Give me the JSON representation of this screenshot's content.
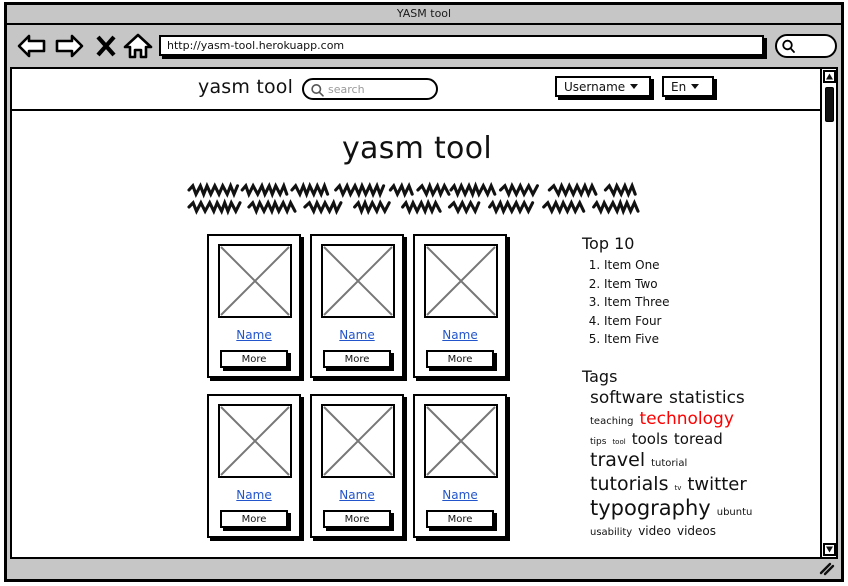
{
  "window": {
    "title": "YASM tool"
  },
  "browser": {
    "back_icon": "back-arrow-icon",
    "forward_icon": "forward-arrow-icon",
    "stop_icon": "close-x-icon",
    "home_icon": "home-icon",
    "url": "http://yasm-tool.herokuapp.com",
    "search_icon": "magnifier-icon"
  },
  "navbar": {
    "logo": "yasm tool",
    "search_placeholder": "search",
    "search_icon": "magnifier-icon",
    "username_label": "Username",
    "language_label": "En"
  },
  "hero": {
    "title": "yasm tool",
    "description_placeholder_lines": 2
  },
  "cards": [
    {
      "name": "Name",
      "button": "More",
      "thumb": "image-placeholder-icon"
    },
    {
      "name": "Name",
      "button": "More",
      "thumb": "image-placeholder-icon"
    },
    {
      "name": "Name",
      "button": "More",
      "thumb": "image-placeholder-icon"
    },
    {
      "name": "Name",
      "button": "More",
      "thumb": "image-placeholder-icon"
    },
    {
      "name": "Name",
      "button": "More",
      "thumb": "image-placeholder-icon"
    },
    {
      "name": "Name",
      "button": "More",
      "thumb": "image-placeholder-icon"
    }
  ],
  "top10": {
    "heading": "Top 10",
    "items": [
      "Item One",
      "Item Two",
      "Item Three",
      "Item Four",
      "Item Five"
    ]
  },
  "tags": {
    "heading": "Tags",
    "lines": [
      [
        {
          "text": "software",
          "size": 17,
          "color": "#111111"
        },
        {
          "text": "statistics",
          "size": 17,
          "color": "#111111"
        }
      ],
      [
        {
          "text": "teaching",
          "size": 10,
          "color": "#111111"
        },
        {
          "text": "technology",
          "size": 17,
          "color": "#ff0000"
        }
      ],
      [
        {
          "text": "tips",
          "size": 9,
          "color": "#111111"
        },
        {
          "text": "tool",
          "size": 7,
          "color": "#111111"
        },
        {
          "text": "tools",
          "size": 15,
          "color": "#111111"
        },
        {
          "text": "toread",
          "size": 15,
          "color": "#111111"
        }
      ],
      [
        {
          "text": "travel",
          "size": 19,
          "color": "#111111"
        },
        {
          "text": "tutorial",
          "size": 10,
          "color": "#111111"
        }
      ],
      [
        {
          "text": "tutorials",
          "size": 19,
          "color": "#111111"
        },
        {
          "text": "tv",
          "size": 7,
          "color": "#111111"
        },
        {
          "text": "twitter",
          "size": 18,
          "color": "#111111"
        }
      ],
      [
        {
          "text": "typography",
          "size": 21,
          "color": "#111111"
        },
        {
          "text": "ubuntu",
          "size": 10,
          "color": "#111111"
        }
      ],
      [
        {
          "text": "usability",
          "size": 10,
          "color": "#111111"
        },
        {
          "text": "video",
          "size": 12,
          "color": "#111111"
        },
        {
          "text": "videos",
          "size": 12,
          "color": "#111111"
        }
      ]
    ]
  },
  "scrollbar": {
    "up_icon": "triangle-up-icon",
    "down_icon": "triangle-down-icon",
    "thumb": "scroll-thumb"
  },
  "statusbar": {
    "resize_grip_icon": "resize-grip-icon"
  },
  "colors": {
    "chrome": "#c6c6c6",
    "link": "#2255cc",
    "accent_red": "#ff0000",
    "ink": "#111111"
  }
}
